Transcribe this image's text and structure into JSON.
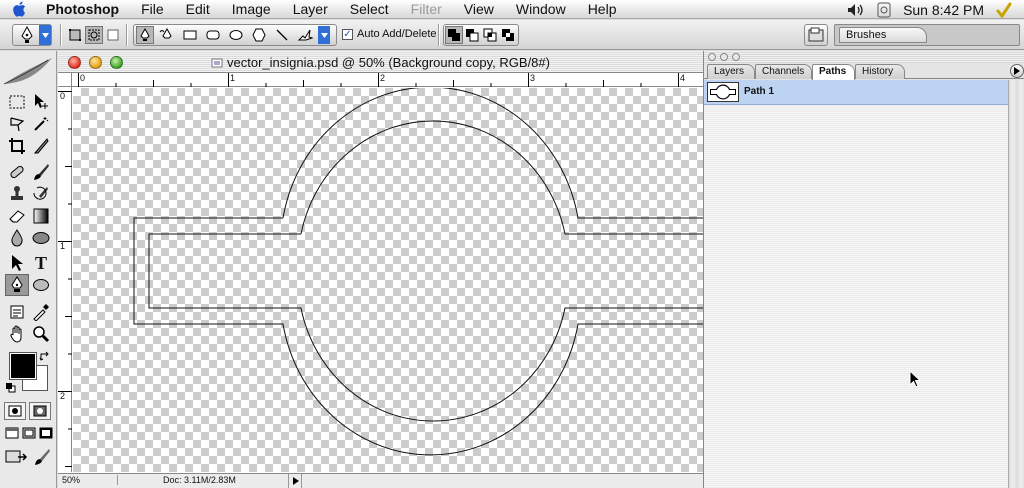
{
  "menubar": {
    "app_name": "Photoshop",
    "items": [
      "File",
      "Edit",
      "Image",
      "Layer",
      "Select",
      "Filter",
      "View",
      "Window",
      "Help"
    ],
    "clock": "Sun 8:42 PM"
  },
  "options": {
    "auto_add_delete_label": "Auto Add/Delete",
    "brushes_label": "Brushes"
  },
  "document": {
    "title": "vector_insignia.psd @ 50% (Background copy, RGB/8#)",
    "ruler_top": [
      "0",
      "1",
      "2",
      "3",
      "4"
    ],
    "ruler_left": [
      "0",
      "1",
      "2"
    ],
    "zoom": "50%",
    "doc_size": "Doc: 3.11M/2.83M"
  },
  "panel": {
    "tabs": [
      "Layers",
      "Channels",
      "Paths",
      "History"
    ],
    "active_tab": "Paths",
    "paths": [
      {
        "name": "Path 1"
      }
    ]
  },
  "colors": {
    "selection": "#bcd3f2",
    "foreground": "#000000",
    "background": "#ffffff"
  }
}
